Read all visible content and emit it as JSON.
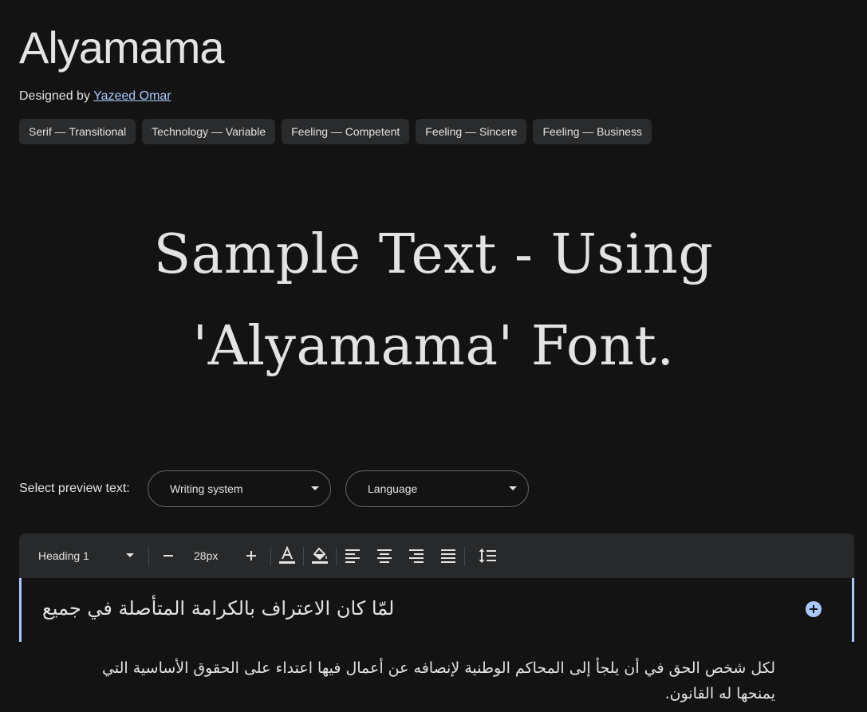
{
  "header": {
    "font_name": "Alyamama",
    "designed_by_prefix": "Designed by ",
    "designer_name": "Yazeed Omar"
  },
  "tags": [
    "Serif — Transitional",
    "Technology — Variable",
    "Feeling — Competent",
    "Feeling — Sincere",
    "Feeling — Business"
  ],
  "sample": {
    "line1": "Sample Text - Using",
    "line2": "'Alyamama' Font."
  },
  "preview": {
    "label": "Select preview text:",
    "writing_system": "Writing system",
    "language": "Language"
  },
  "toolbar": {
    "style_value": "Heading 1",
    "font_size": "28px",
    "icons": [
      "decrease-size-icon",
      "increase-size-icon",
      "text-color-icon",
      "highlight-color-icon",
      "align-left-icon",
      "align-center-icon",
      "align-right-icon",
      "align-justify-icon",
      "line-spacing-icon"
    ]
  },
  "editor": {
    "heading": "لمّا كان الاعتراف بالكرامة المتأصلة في جميع",
    "body_line1": "لكل شخص الحق في أن يلجأ إلى المحاكم الوطنية لإنصافه عن أعمال فيها اعتداء على الحقوق الأساسية التي",
    "body_line2": "يمنحها له القانون."
  },
  "colors": {
    "background": "#131314",
    "text": "#e3e3e3",
    "link": "#a8c7fa",
    "toolbar": "#28292a",
    "chip": "#2a2b2c",
    "accent": "#a8c7fa"
  }
}
